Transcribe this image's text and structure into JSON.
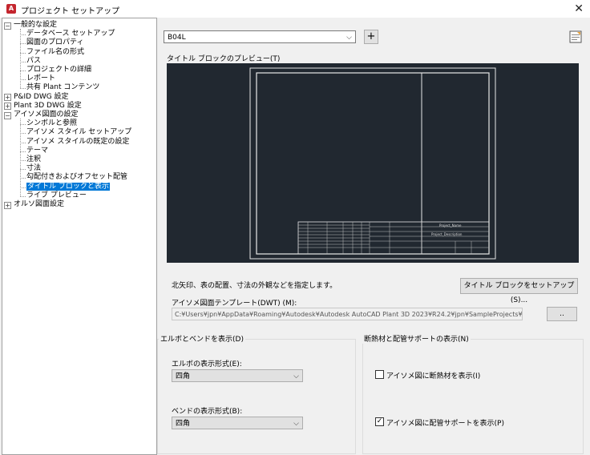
{
  "window": {
    "title": "プロジェクト セットアップ",
    "app_icon_letter": "A",
    "close_glyph": "✕"
  },
  "tree": {
    "items": [
      {
        "label": "一般的な設定",
        "level": 0,
        "expander": "−"
      },
      {
        "label": "データベース セットアップ",
        "level": 1
      },
      {
        "label": "図面のプロパティ",
        "level": 1
      },
      {
        "label": "ファイル名の形式",
        "level": 1
      },
      {
        "label": "パス",
        "level": 1
      },
      {
        "label": "プロジェクトの詳細",
        "level": 1
      },
      {
        "label": "レポート",
        "level": 1
      },
      {
        "label": "共有 Plant コンテンツ",
        "level": 1
      },
      {
        "label": "P&ID DWG 設定",
        "level": 0,
        "expander": "+"
      },
      {
        "label": "Plant 3D DWG 設定",
        "level": 0,
        "expander": "+"
      },
      {
        "label": "アイソメ図面の設定",
        "level": 0,
        "expander": "−"
      },
      {
        "label": "シンボルと参照",
        "level": 1
      },
      {
        "label": "アイソメ スタイル セットアップ",
        "level": 1
      },
      {
        "label": "アイソメ スタイルの既定の設定",
        "level": 1
      },
      {
        "label": "テーマ",
        "level": 1
      },
      {
        "label": "注釈",
        "level": 1
      },
      {
        "label": "寸法",
        "level": 1
      },
      {
        "label": "勾配付きおよびオフセット配管",
        "level": 1
      },
      {
        "label": "タイトル ブロックと表示",
        "level": 1,
        "selected": true
      },
      {
        "label": "ライブ プレビュー",
        "level": 1
      },
      {
        "label": "オルソ図面設定",
        "level": 0,
        "expander": "+"
      }
    ]
  },
  "main": {
    "style_combo": {
      "value": "B04L",
      "arrow": "⌵"
    },
    "add_button": "+",
    "preview_label": "タイトル ブロックのプレビュー(T)",
    "description": "北矢印、表の配置、寸法の外観などを指定します。",
    "setup_button": "タイトル ブロックをセットアップ(S)...",
    "template_label": "アイソメ図面テンプレート(DWT) (M):",
    "template_path": "C:¥Users¥jpn¥AppData¥Roaming¥Autodesk¥Autodesk AutoCAD Plant 3D 2023¥R24.2¥jpn¥SampleProjects¥",
    "browse_button": "..",
    "titleblock_cells": [
      "Project_Name",
      "Project_Description"
    ]
  },
  "elbow_group": {
    "title": "エルボとベンドを表示(D)",
    "elbow_label": "エルボの表示形式(E):",
    "elbow_value": "四角",
    "bend_label": "ベンドの表示形式(B):",
    "bend_value": "四角",
    "arrow": "⌵"
  },
  "insulation_group": {
    "title": "断熱材と配管サポートの表示(N)",
    "show_insulation": {
      "label": "アイソメ図に断熱材を表示(I)",
      "checked": false
    },
    "show_supports": {
      "label": "アイソメ図に配管サポートを表示(P)",
      "checked": true
    }
  },
  "colors": {
    "selection": "#0078d7",
    "preview_bg": "#212830",
    "app_icon": "#c4262e"
  }
}
